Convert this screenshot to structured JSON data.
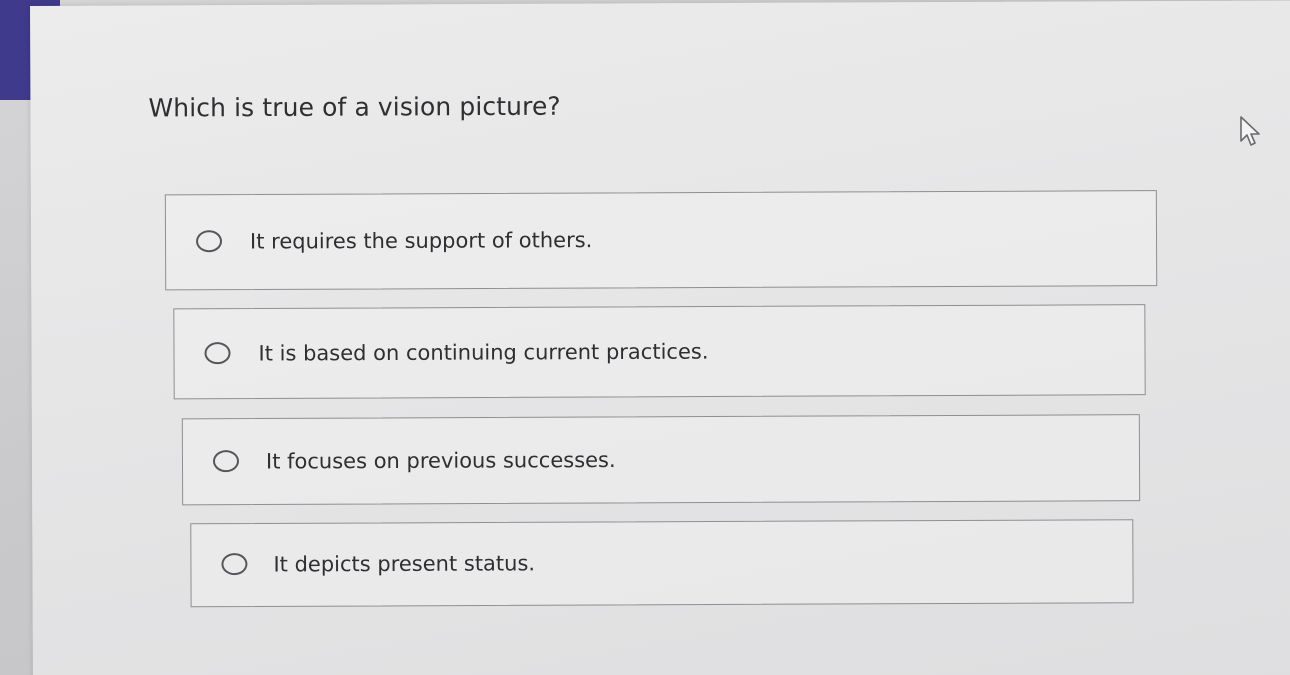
{
  "question": {
    "text": "Which is true of a vision picture?"
  },
  "options": [
    {
      "label": "It requires the support of others.",
      "selected": false
    },
    {
      "label": "It is based on continuing current practices.",
      "selected": false
    },
    {
      "label": "It focuses on previous successes.",
      "selected": false
    },
    {
      "label": "It depicts present status.",
      "selected": false
    }
  ],
  "colors": {
    "accent": "#3f3a8c",
    "text": "#2f2f33",
    "border": "#8e8e93"
  },
  "icons": {
    "cursor": "pointer-cursor-icon",
    "radio": "radio-circle-icon"
  }
}
